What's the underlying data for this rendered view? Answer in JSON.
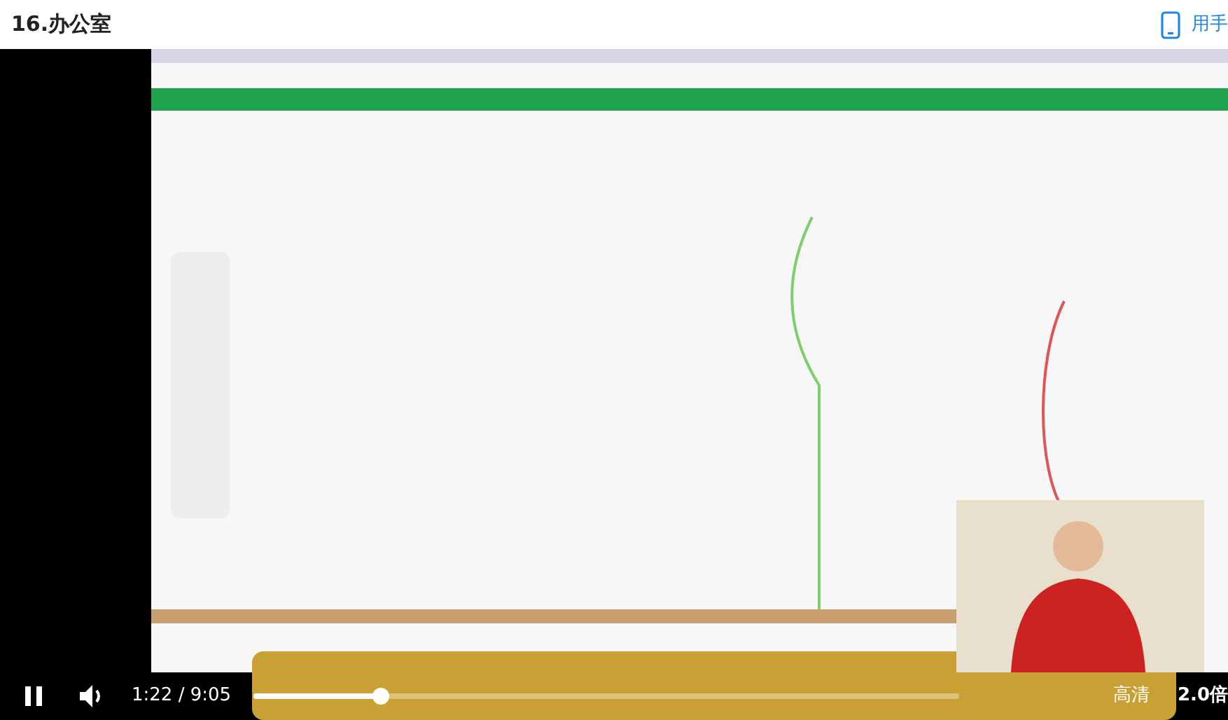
{
  "header": {
    "title": "16.办公室",
    "link": "用手"
  },
  "player": {
    "kind": "picture",
    "playing": true,
    "time": "1:22 / 9:05",
    "progress": {
      "level": 0.18
    },
    "quality": "高清",
    "speed": "2.0倍"
  }
}
